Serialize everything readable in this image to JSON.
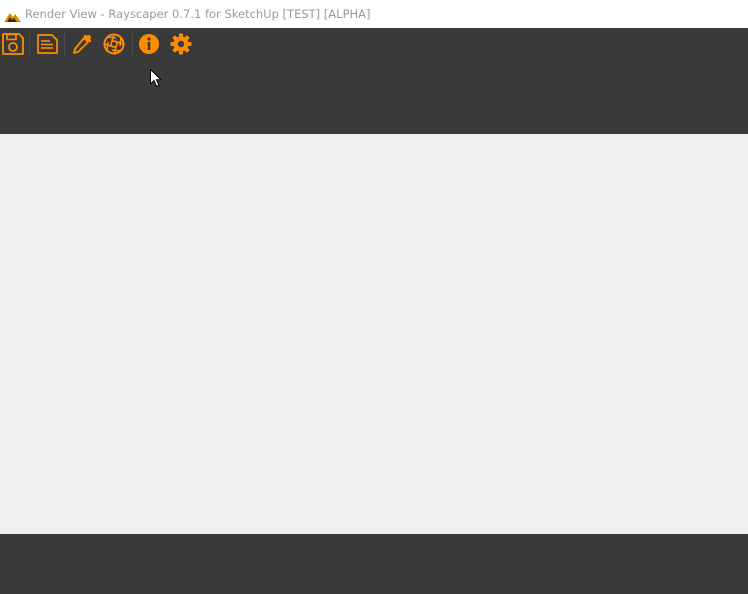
{
  "window": {
    "title": "Render View - Rayscaper 0.7.1 for SketchUp [TEST] [ALPHA]",
    "app_icon": "rayscaper-mountain-icon"
  },
  "toolbar": {
    "accent_color": "#ff8c00",
    "background_color": "#3a3a3a",
    "buttons": [
      {
        "id": "save",
        "icon": "save-render-icon"
      },
      {
        "id": "log",
        "icon": "log-document-icon"
      },
      {
        "id": "picker",
        "icon": "eyedropper-icon"
      },
      {
        "id": "camera",
        "icon": "aperture-icon"
      },
      {
        "id": "info",
        "icon": "info-icon"
      },
      {
        "id": "settings",
        "icon": "gear-icon"
      }
    ]
  },
  "colors": {
    "panel": "#3a3a3a",
    "canvas": "#f0f0f0",
    "title_text": "#9a9a9a"
  }
}
